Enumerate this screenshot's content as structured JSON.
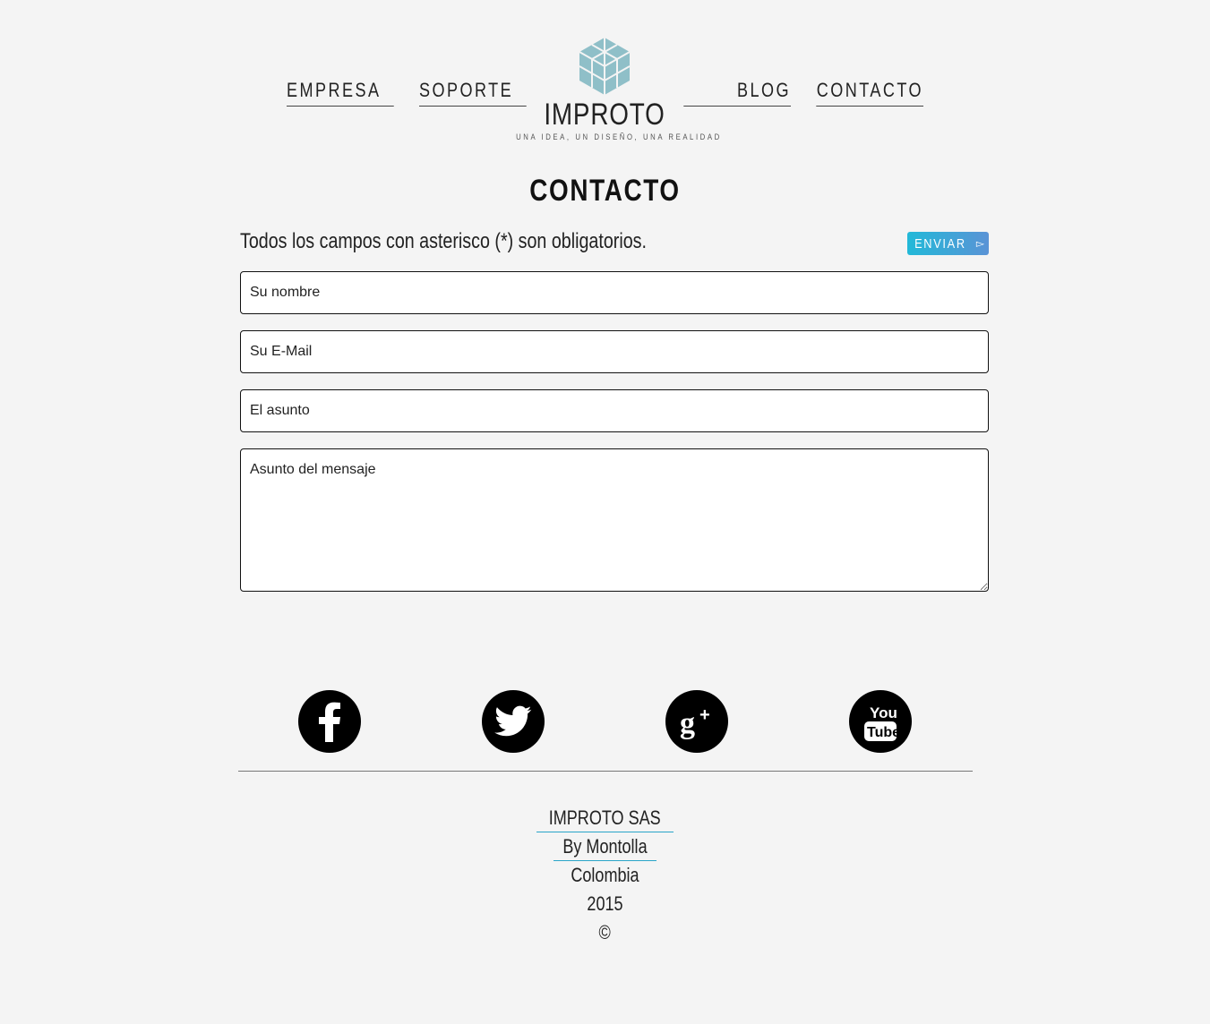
{
  "nav": {
    "left": [
      {
        "label": "EMPRESA"
      },
      {
        "label": "SOPORTE"
      }
    ],
    "right": [
      {
        "label": "BLOG"
      },
      {
        "label": "CONTACTO"
      }
    ]
  },
  "logo": {
    "name": "IMPROTO",
    "tagline": "UNA IDEA, UN DISEÑO, UNA REALIDAD",
    "color": "#8fbfc8"
  },
  "page_title": "CONTACTO",
  "form": {
    "notice": "Todos los campos con asterisco (*) son obligatorios.",
    "send_label": "ENVIAR",
    "send_icon": "send-arrow-icon",
    "button_gradient": [
      "#22b9d8",
      "#5a93d6"
    ],
    "fields": {
      "name_placeholder": "Su nombre",
      "email_placeholder": "Su E-Mail",
      "subject_placeholder": "El asunto",
      "message_placeholder": "Asunto del mensaje"
    }
  },
  "social": [
    {
      "icon": "facebook-icon"
    },
    {
      "icon": "twitter-icon"
    },
    {
      "icon": "google-plus-icon"
    },
    {
      "icon": "youtube-icon"
    }
  ],
  "footer": {
    "company": "IMPROTO SAS",
    "author": "By Montolla",
    "country": "Colombia",
    "year": "2015",
    "copyright": "©",
    "link_underline_color": "#2aa5c9"
  }
}
